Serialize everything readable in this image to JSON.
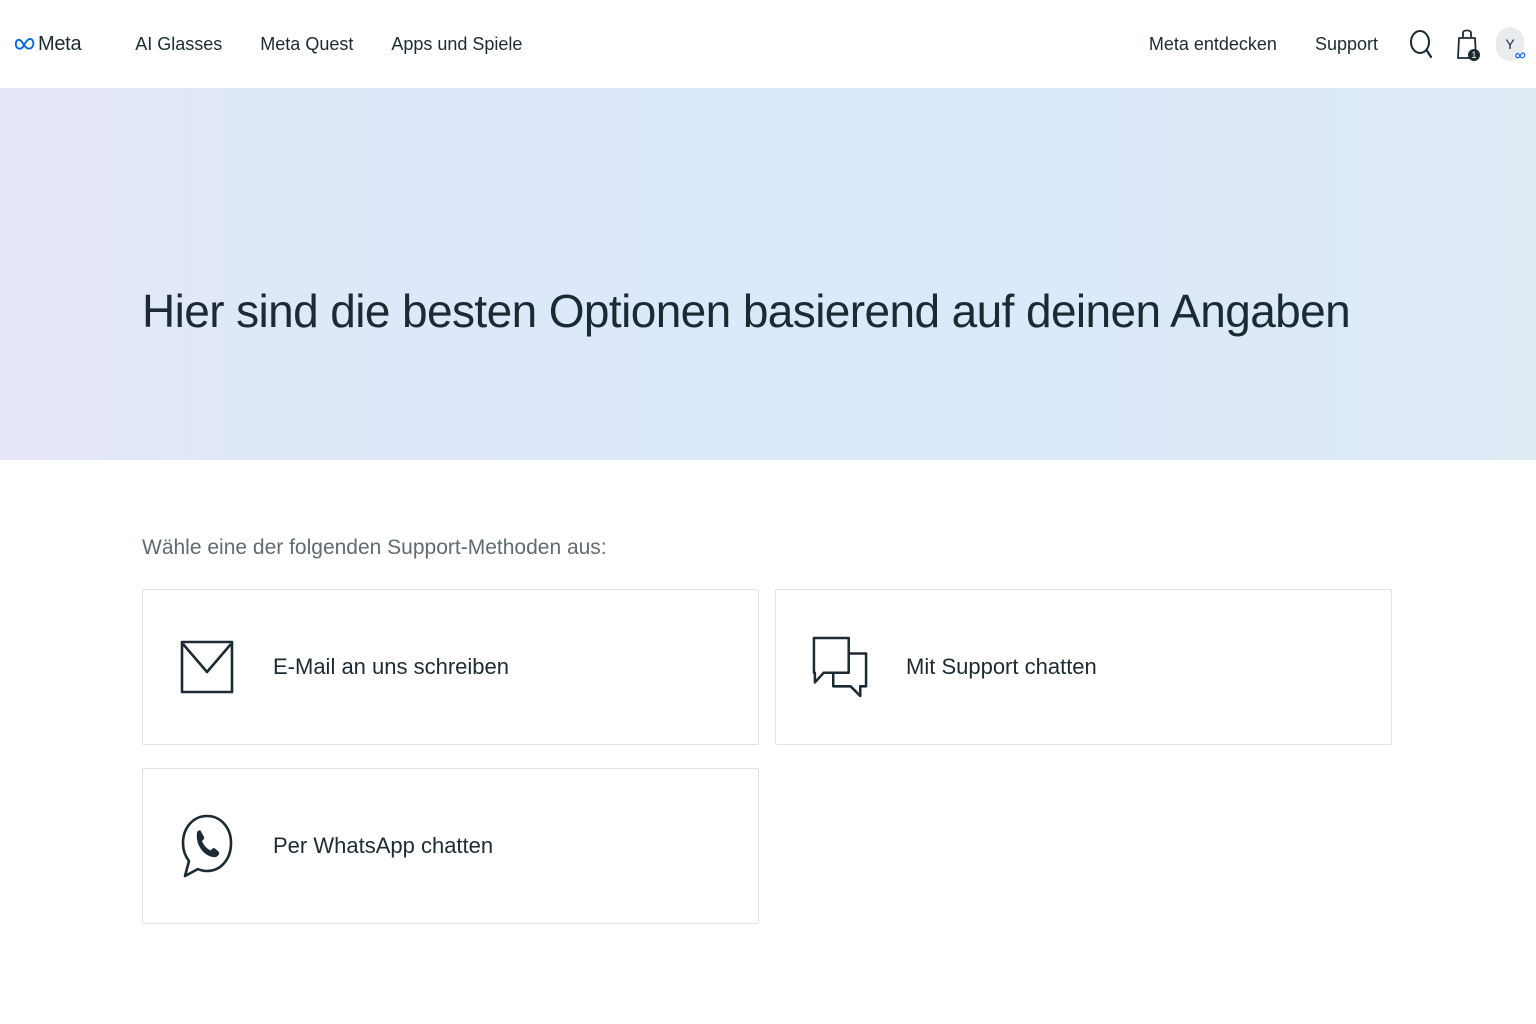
{
  "header": {
    "logo_text": "Meta",
    "nav_left": [
      "AI Glasses",
      "Meta Quest",
      "Apps und Spiele"
    ],
    "nav_right": [
      "Meta entdecken",
      "Support"
    ],
    "icons": {
      "search": "search-icon",
      "bag": "shopping-bag-icon"
    },
    "cart_count": "1",
    "avatar_letter": "Y"
  },
  "hero": {
    "title": "Hier sind die besten Optionen basierend auf deinen Angaben"
  },
  "support": {
    "prompt": "Wähle eine der folgenden Support-Methoden aus:",
    "options": [
      {
        "label": "E-Mail an uns schreiben",
        "icon": "envelope-icon"
      },
      {
        "label": "Mit Support chatten",
        "icon": "chat-bubbles-icon"
      },
      {
        "label": "Per WhatsApp chatten",
        "icon": "whatsapp-icon"
      }
    ]
  },
  "colors": {
    "brand_blue": "#0064e0",
    "text": "#1c2b33",
    "muted_text": "#5f6b73",
    "card_border": "#dde2e5",
    "hero_bg": "#dce9fa"
  }
}
